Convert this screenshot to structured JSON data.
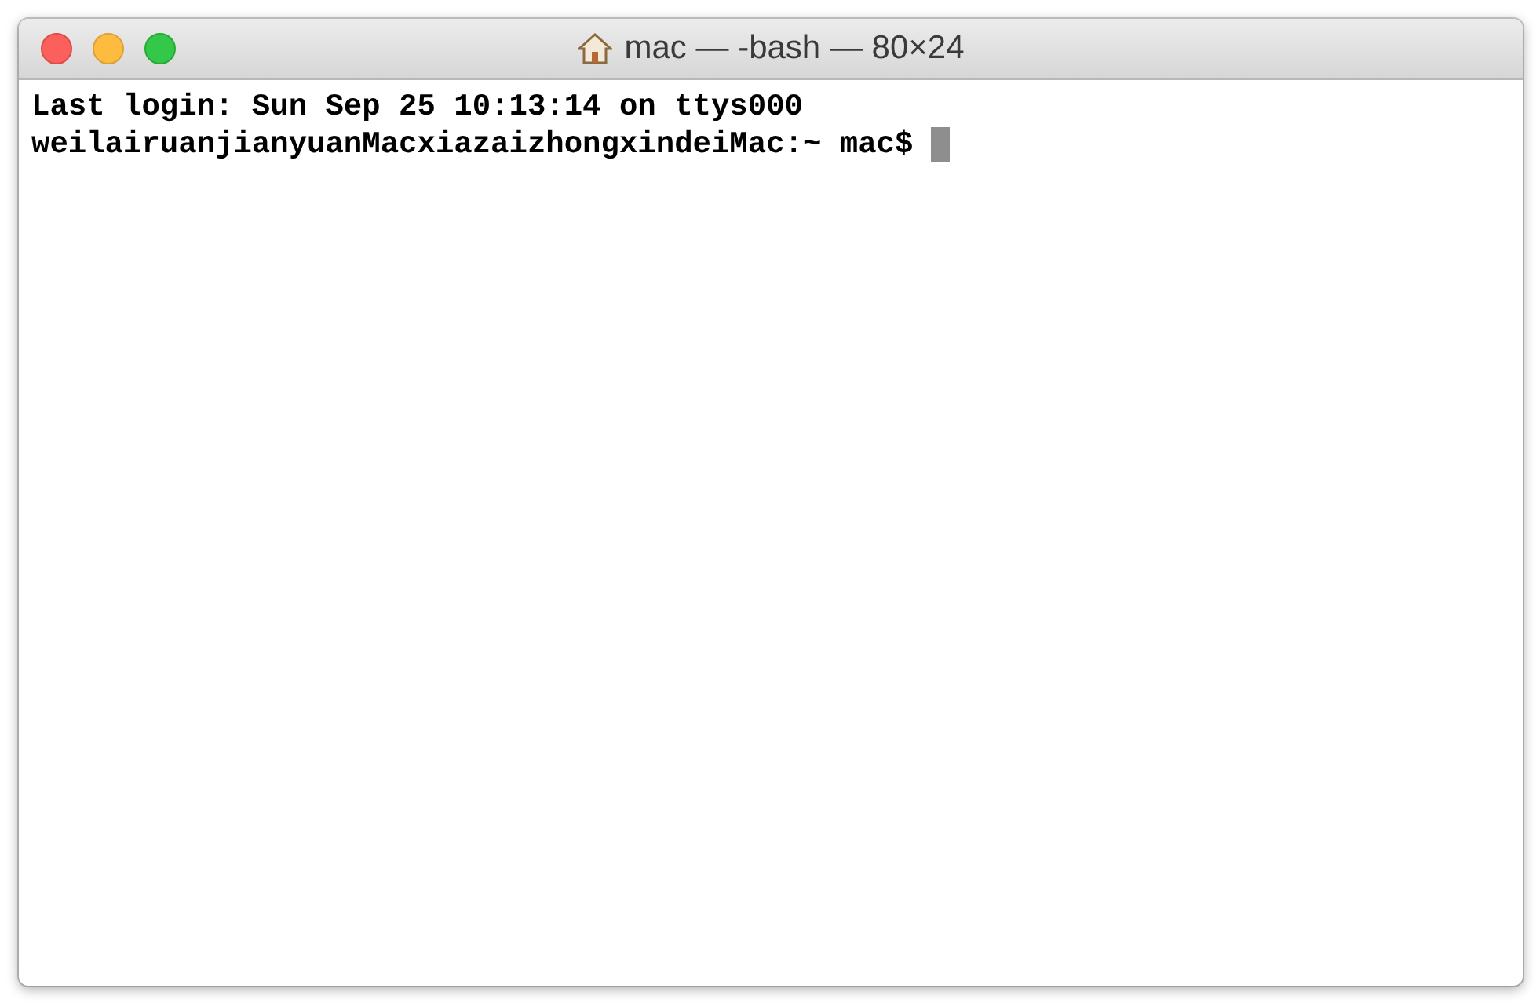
{
  "window": {
    "title": "mac — -bash — 80×24"
  },
  "terminal": {
    "lines": [
      "Last login: Sun Sep 25 10:13:14 on ttys000",
      "weilairuanjianyuanMacxiazaizhongxindeiMac:~ mac$ "
    ],
    "cursor": true
  }
}
